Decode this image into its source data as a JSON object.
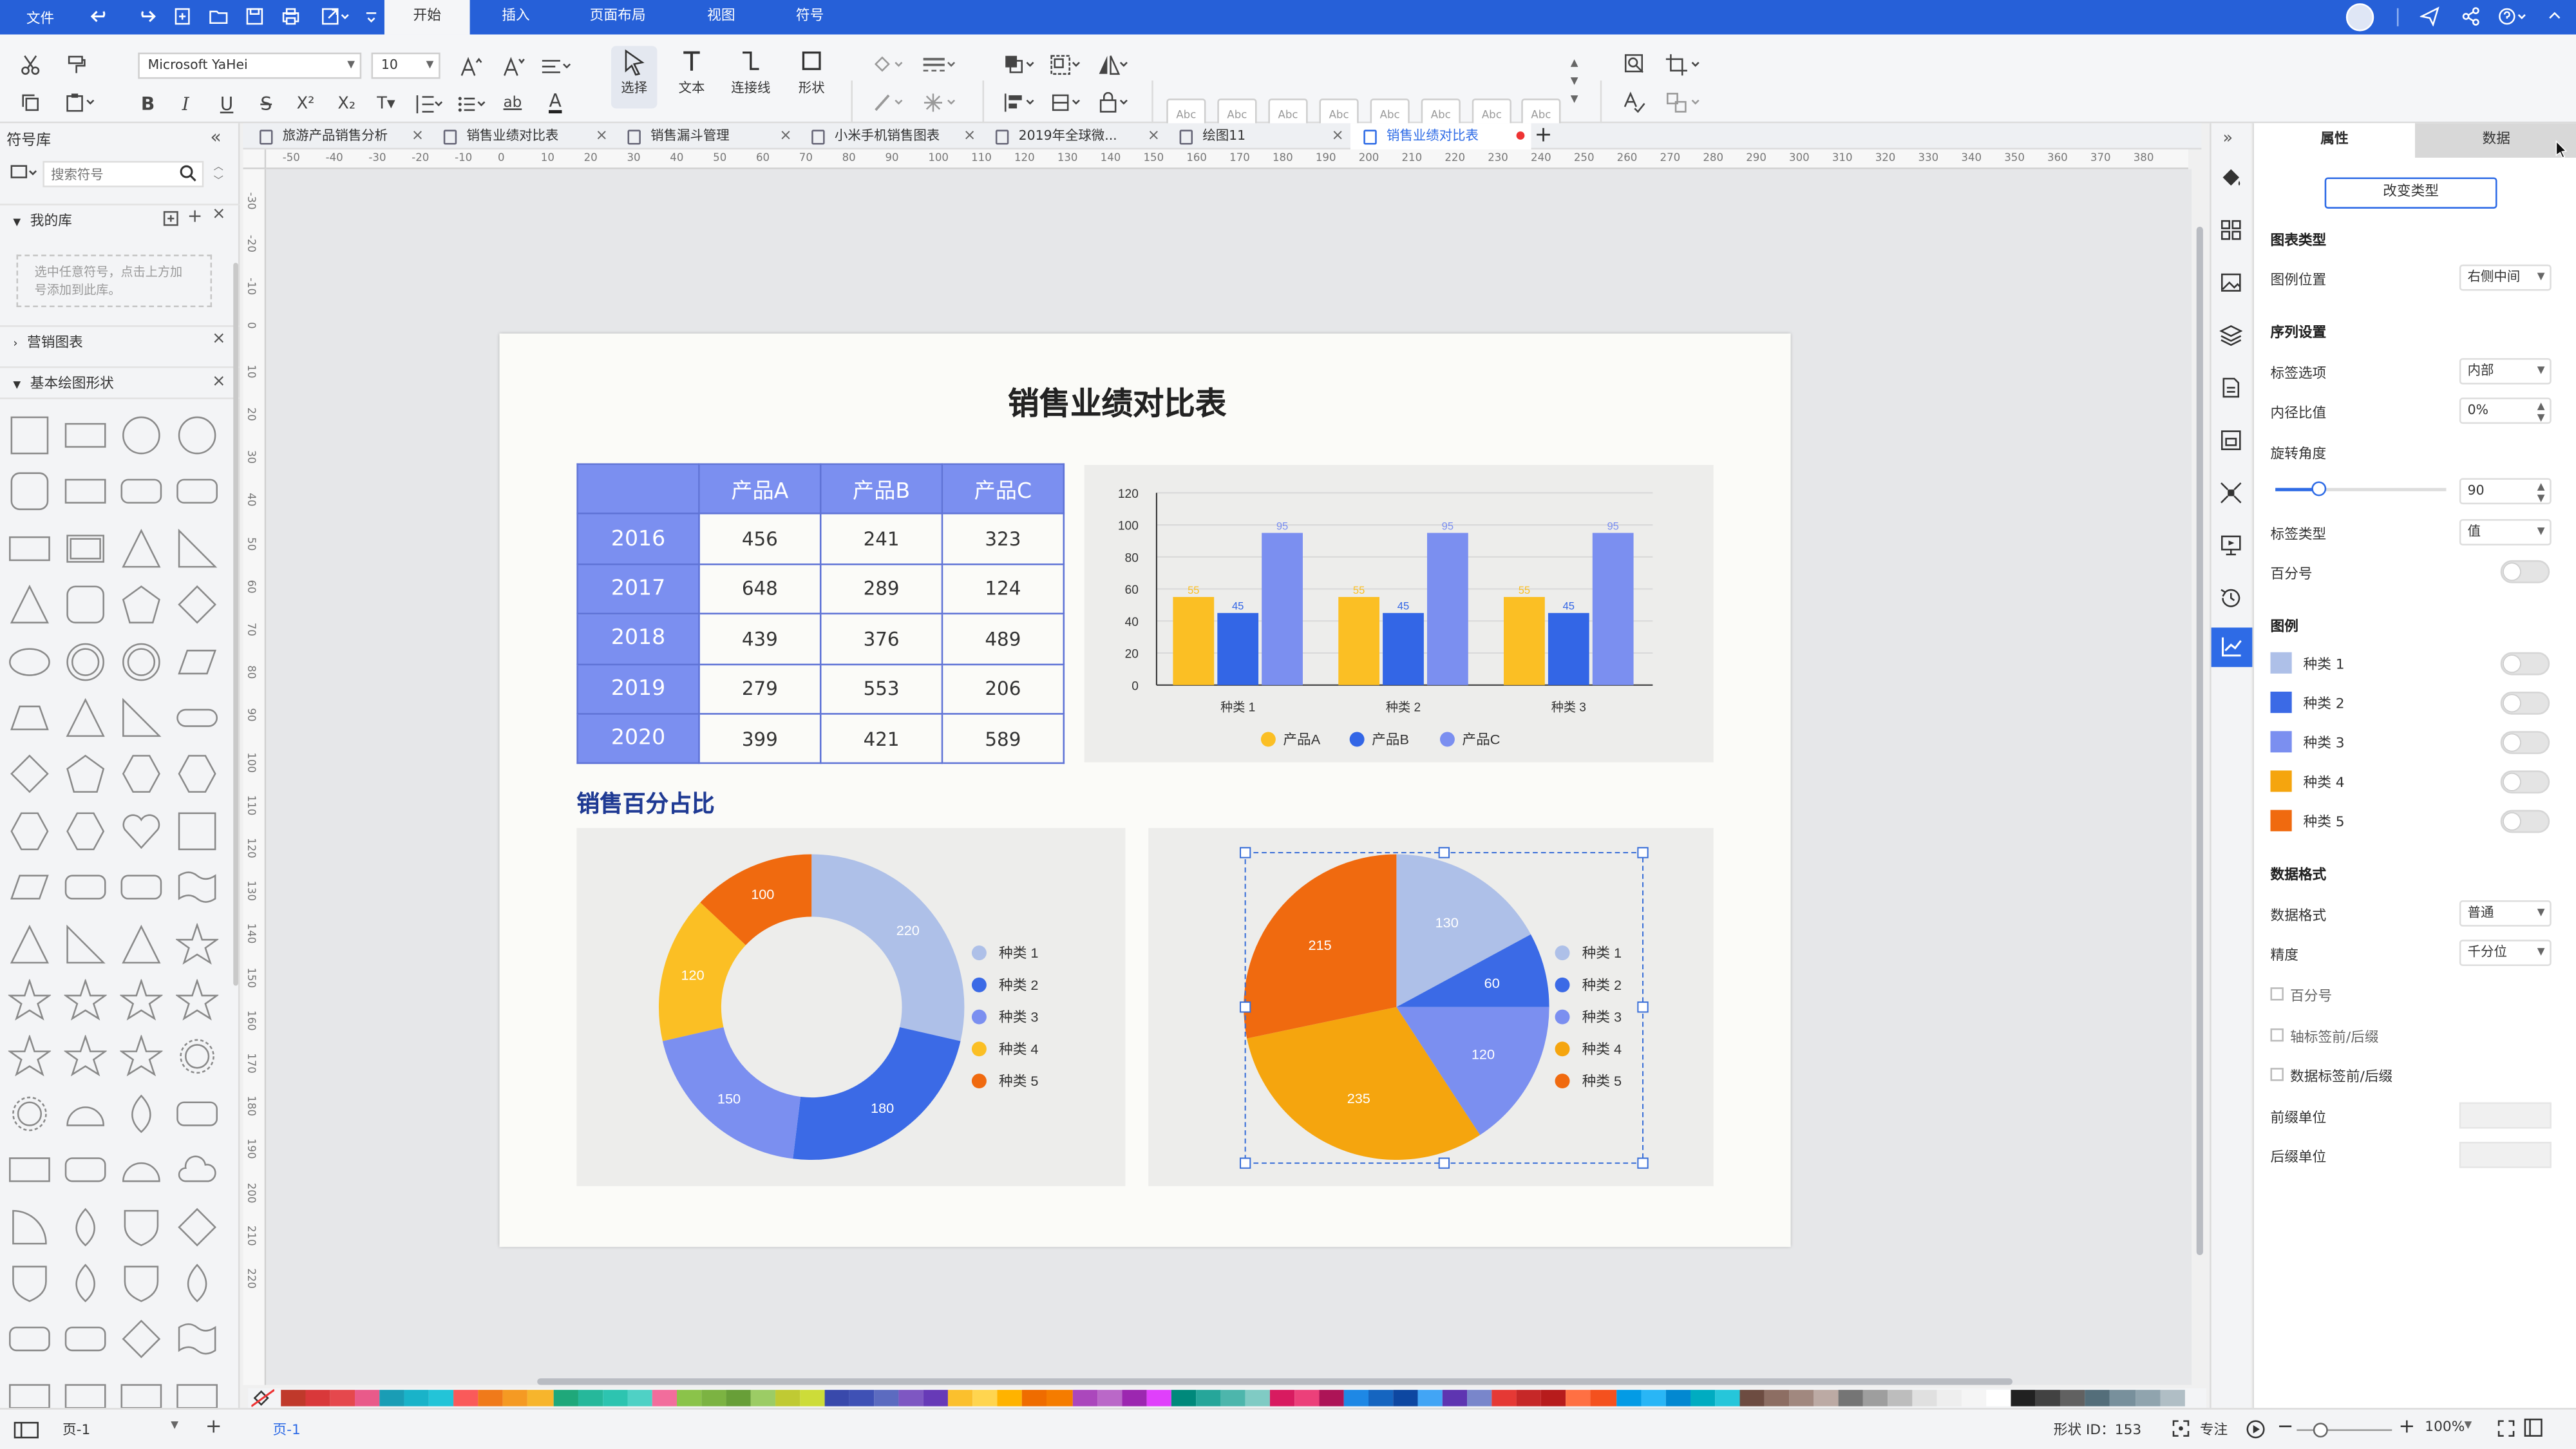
{
  "menubar": {
    "file": "文件",
    "tabs": [
      "开始",
      "插入",
      "页面布局",
      "视图",
      "符号"
    ],
    "active_tab": "开始"
  },
  "toolbar": {
    "font_family": "Microsoft YaHei",
    "font_size": "10",
    "tools": [
      "选择",
      "文本",
      "连接线",
      "形状"
    ],
    "style_preview": "Abc"
  },
  "leftpanel": {
    "title": "符号库",
    "search_placeholder": "搜索符号",
    "my_library": "我的库",
    "my_library_hint": "选中任意符号，点击上方加号添加到此库。",
    "marketing_charts": "营销图表",
    "basic_shapes": "基本绘图形状"
  },
  "doctabs": [
    "旅游产品销售分析",
    "销售业绩对比表",
    "销售漏斗管理",
    "小米手机销售图表",
    "2019年全球微...",
    "绘图11",
    "销售业绩对比表"
  ],
  "ruler": {
    "h": [
      "-50",
      "-40",
      "-30",
      "-20",
      "-10",
      "0",
      "10",
      "20",
      "30",
      "40",
      "50",
      "60",
      "70",
      "80",
      "90",
      "100",
      "110",
      "120",
      "130",
      "140",
      "150",
      "160",
      "170",
      "180",
      "190",
      "200",
      "210",
      "220",
      "230",
      "240",
      "250",
      "260",
      "270",
      "280",
      "290",
      "300",
      "310",
      "320",
      "330",
      "340",
      "350",
      "360",
      "370",
      "380"
    ],
    "v": [
      "-30",
      "-20",
      "-10",
      "0",
      "10",
      "20",
      "30",
      "40",
      "50",
      "60",
      "70",
      "80",
      "90",
      "100",
      "110",
      "120",
      "130",
      "140",
      "150",
      "160",
      "170",
      "180",
      "190",
      "200",
      "210",
      "220"
    ]
  },
  "page": {
    "title": "销售业绩对比表",
    "section_title": "销售百分占比"
  },
  "table": {
    "header": [
      "",
      "产品A",
      "产品B",
      "产品C"
    ],
    "rows": [
      [
        "2016",
        "456",
        "241",
        "323"
      ],
      [
        "2017",
        "648",
        "289",
        "124"
      ],
      [
        "2018",
        "439",
        "376",
        "489"
      ],
      [
        "2019",
        "279",
        "553",
        "206"
      ],
      [
        "2020",
        "399",
        "421",
        "589"
      ]
    ]
  },
  "chart_data": [
    {
      "type": "bar",
      "categories": [
        "种类 1",
        "种类 2",
        "种类 3"
      ],
      "series": [
        {
          "name": "产品A",
          "values": [
            55,
            55,
            55
          ],
          "color": "#fbbf24"
        },
        {
          "name": "产品B",
          "values": [
            45,
            45,
            45
          ],
          "color": "#3366e6"
        },
        {
          "name": "产品C",
          "values": [
            95,
            95,
            95
          ],
          "color": "#7b8ff0"
        }
      ],
      "ylim": [
        0,
        120
      ],
      "yticks": [
        "0",
        "20",
        "40",
        "60",
        "80",
        "100",
        "120"
      ],
      "legend": "bottom",
      "grid": true
    },
    {
      "type": "donut",
      "categories": [
        "种类 1",
        "种类 2",
        "种类 3",
        "种类 4",
        "种类 5"
      ],
      "values": [
        220,
        180,
        150,
        120,
        100
      ],
      "colors": [
        "#aec0e8",
        "#3b6ae6",
        "#7b8ff0",
        "#fbbf24",
        "#f06a0f"
      ],
      "legend": "right"
    },
    {
      "type": "pie",
      "categories": [
        "种类 1",
        "种类 2",
        "种类 3",
        "种类 4",
        "种类 5"
      ],
      "values": [
        130,
        60,
        120,
        235,
        215
      ],
      "colors": [
        "#aec0e8",
        "#3b6ae6",
        "#7b8ff0",
        "#f5a50e",
        "#f06a0f"
      ],
      "legend": "right"
    }
  ],
  "props": {
    "tab_attr": "属性",
    "tab_data": "数据",
    "change_type": "改变类型",
    "chart_type": "图表类型",
    "legend_pos_label": "图例位置",
    "legend_pos": "右侧中间",
    "series_settings": "序列设置",
    "label_option_label": "标签选项",
    "label_option": "内部",
    "inner_ratio_label": "内径比值",
    "inner_ratio": "0%",
    "rotation_label": "旋转角度",
    "rotation": "90",
    "rotation_fraction": 0.25,
    "label_type_label": "标签类型",
    "label_type": "值",
    "percent_label": "百分号",
    "legend_head": "图例",
    "legend_items": [
      "种类 1",
      "种类 2",
      "种类 3",
      "种类 4",
      "种类 5"
    ],
    "legend_colors": [
      "#aec0e8",
      "#3b6ae6",
      "#7b8ff0",
      "#f5a50e",
      "#f06a0f"
    ],
    "data_format_head": "数据格式",
    "data_format_label": "数据格式",
    "data_format": "普通",
    "precision_label": "精度",
    "precision": "千分位",
    "cb_percent": "百分号",
    "cb_axis": "轴标签前/后缀",
    "cb_datalabel": "数据标签前/后缀",
    "prefix_unit": "前缀单位",
    "suffix_unit": "后缀单位"
  },
  "status": {
    "page_select": "页-1",
    "page_tab": "页-1",
    "shape_id": "形状 ID：153",
    "focus": "专注",
    "zoom": "100%"
  },
  "palette": [
    "#c0392b",
    "#d9383a",
    "#e5484d",
    "#e95a8a",
    "#1a9db5",
    "#19b3c9",
    "#23c4d8",
    "#fa5a5a",
    "#f07a1a",
    "#f59a23",
    "#f7b52c",
    "#1fa87a",
    "#26b89b",
    "#2dc4b0",
    "#4fd1c5",
    "#f26d9c",
    "#8bc34a",
    "#7cb342",
    "#689f38",
    "#9ccc65",
    "#c0ca33",
    "#cddc39",
    "#3949ab",
    "#3f51b5",
    "#5c6bc0",
    "#7e57c2",
    "#673ab7",
    "#fbc02d",
    "#ffd54f",
    "#ffb300",
    "#ef6c00",
    "#f57c00",
    "#ab47bc",
    "#ba68c8",
    "#9c27b0",
    "#e040fb",
    "#00897b",
    "#26a69a",
    "#4db6ac",
    "#80cbc4",
    "#d81b60",
    "#ec407a",
    "#ad1457",
    "#1e88e5",
    "#1565c0",
    "#0d47a1",
    "#42a5f5",
    "#5e35b1",
    "#7986cb",
    "#e53935",
    "#c62828",
    "#b71c1c",
    "#ff7043",
    "#f4511e",
    "#039be5",
    "#29b6f6",
    "#0288d1",
    "#00acc1",
    "#26c6da",
    "#6d4c41",
    "#8d6e63",
    "#a1887f",
    "#bcaaa4",
    "#757575",
    "#9e9e9e",
    "#bdbdbd",
    "#e0e0e0",
    "#eeeeee",
    "#f5f5f5",
    "#ffffff",
    "#212121",
    "#424242",
    "#616161",
    "#546e7a",
    "#78909c",
    "#90a4ae",
    "#b0bec5"
  ]
}
